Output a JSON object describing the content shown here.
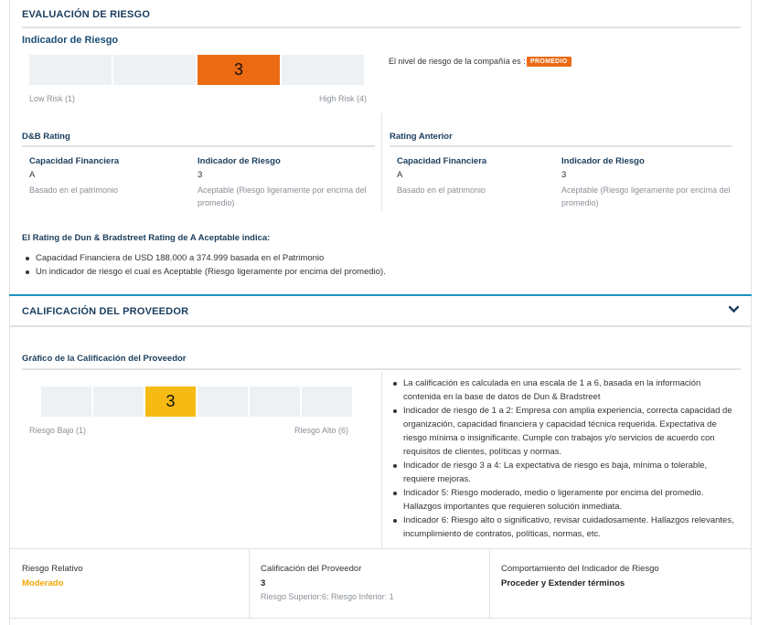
{
  "riesgo": {
    "title": "EVALUACIÓN DE RIESGO",
    "indicator_title": "Indicador de Riesgo",
    "bar_value": "3",
    "low_label": "Low Risk (1)",
    "high_label": "High Risk (4)",
    "level_text": "El nivel de riesgo de la compañía es :",
    "badge": "PROMEDIO",
    "accent_color": "#ec6a12"
  },
  "dnb": {
    "title": "D&B Rating",
    "col1_label": "Capacidad Financiera",
    "col1_value": "A",
    "col1_desc": "Basado en el patrimonio",
    "col2_label": "Indicador de Riesgo",
    "col2_value": "3",
    "col2_desc_1": "Aceptable (Riesgo ligeramente por encima del",
    "col2_desc_2": "promedio)"
  },
  "anterior": {
    "title": "Rating Anterior",
    "col1_label": "Capacidad Financiera",
    "col1_value": "A",
    "col1_desc": "Basado en el patrimonio",
    "col2_label": "Indicador de Riesgo",
    "col2_value": "3",
    "col2_desc_1": "Aceptable (Riesgo ligeramente por encima del",
    "col2_desc_2": "promedio)"
  },
  "summary": {
    "heading": "El Rating de Dun & Bradstreet Rating de A Aceptable indica:",
    "items": [
      "Capacidad Financiera de USD 188.000 a 374.999 basada en el Patrimonio",
      "Un indicador de riesgo el cual es Aceptable (Riesgo ligeramente por encima del promedio)."
    ]
  },
  "proveedor": {
    "title": "CALIFICACIÓN DEL PROVEEDOR",
    "chart_title": "Gráfico de la Calificación del Proveedor",
    "bar_value": "3",
    "low_label": "Riesgo Bajo (1)",
    "high_label": "Riesgo Alto (6)",
    "accent_color": "#f5bb14",
    "info": [
      "La calificación es calculada en una escala de 1 a 6, basada en la información contenida en la base de datos de Dun & Bradstreet",
      "Indicador de riesgo de 1 a 2: Empresa con amplia experiencia, correcta capacidad de organización, capacidad financiera y capacidad técnica requerida. Expectativa de riesgo mínima o insignificante. Cumple con trabajos y/o servicios de acuerdo con requisitos de clientes, políticas y normas.",
      "Indicador de riesgo 3 a 4: La expectativa de riesgo es baja, mínima o tolerable, requiere mejoras.",
      "Indicador 5: Riesgo moderado, medio o ligeramente por encima del promedio. Hallazgos importantes que requieren solución inmediata.",
      "Indicador 6: Riesgo alto o significativo, revisar cuidadosamente. Hallazgos relevantes, incumplimiento de contratos, políticas, normas, etc."
    ]
  },
  "bottom": {
    "relativo_label": "Riesgo Relativo",
    "relativo_value": "Moderado",
    "relativo_color": "#f0a500",
    "calif_label": "Calificación del Proveedor",
    "calif_value": "3",
    "calif_sub": "Riesgo Superior:6; Riesgo Inferior: 1",
    "comp_label": "Comportamiento del Indicador de Riesgo",
    "comp_value": "Proceder y Extender términos"
  }
}
